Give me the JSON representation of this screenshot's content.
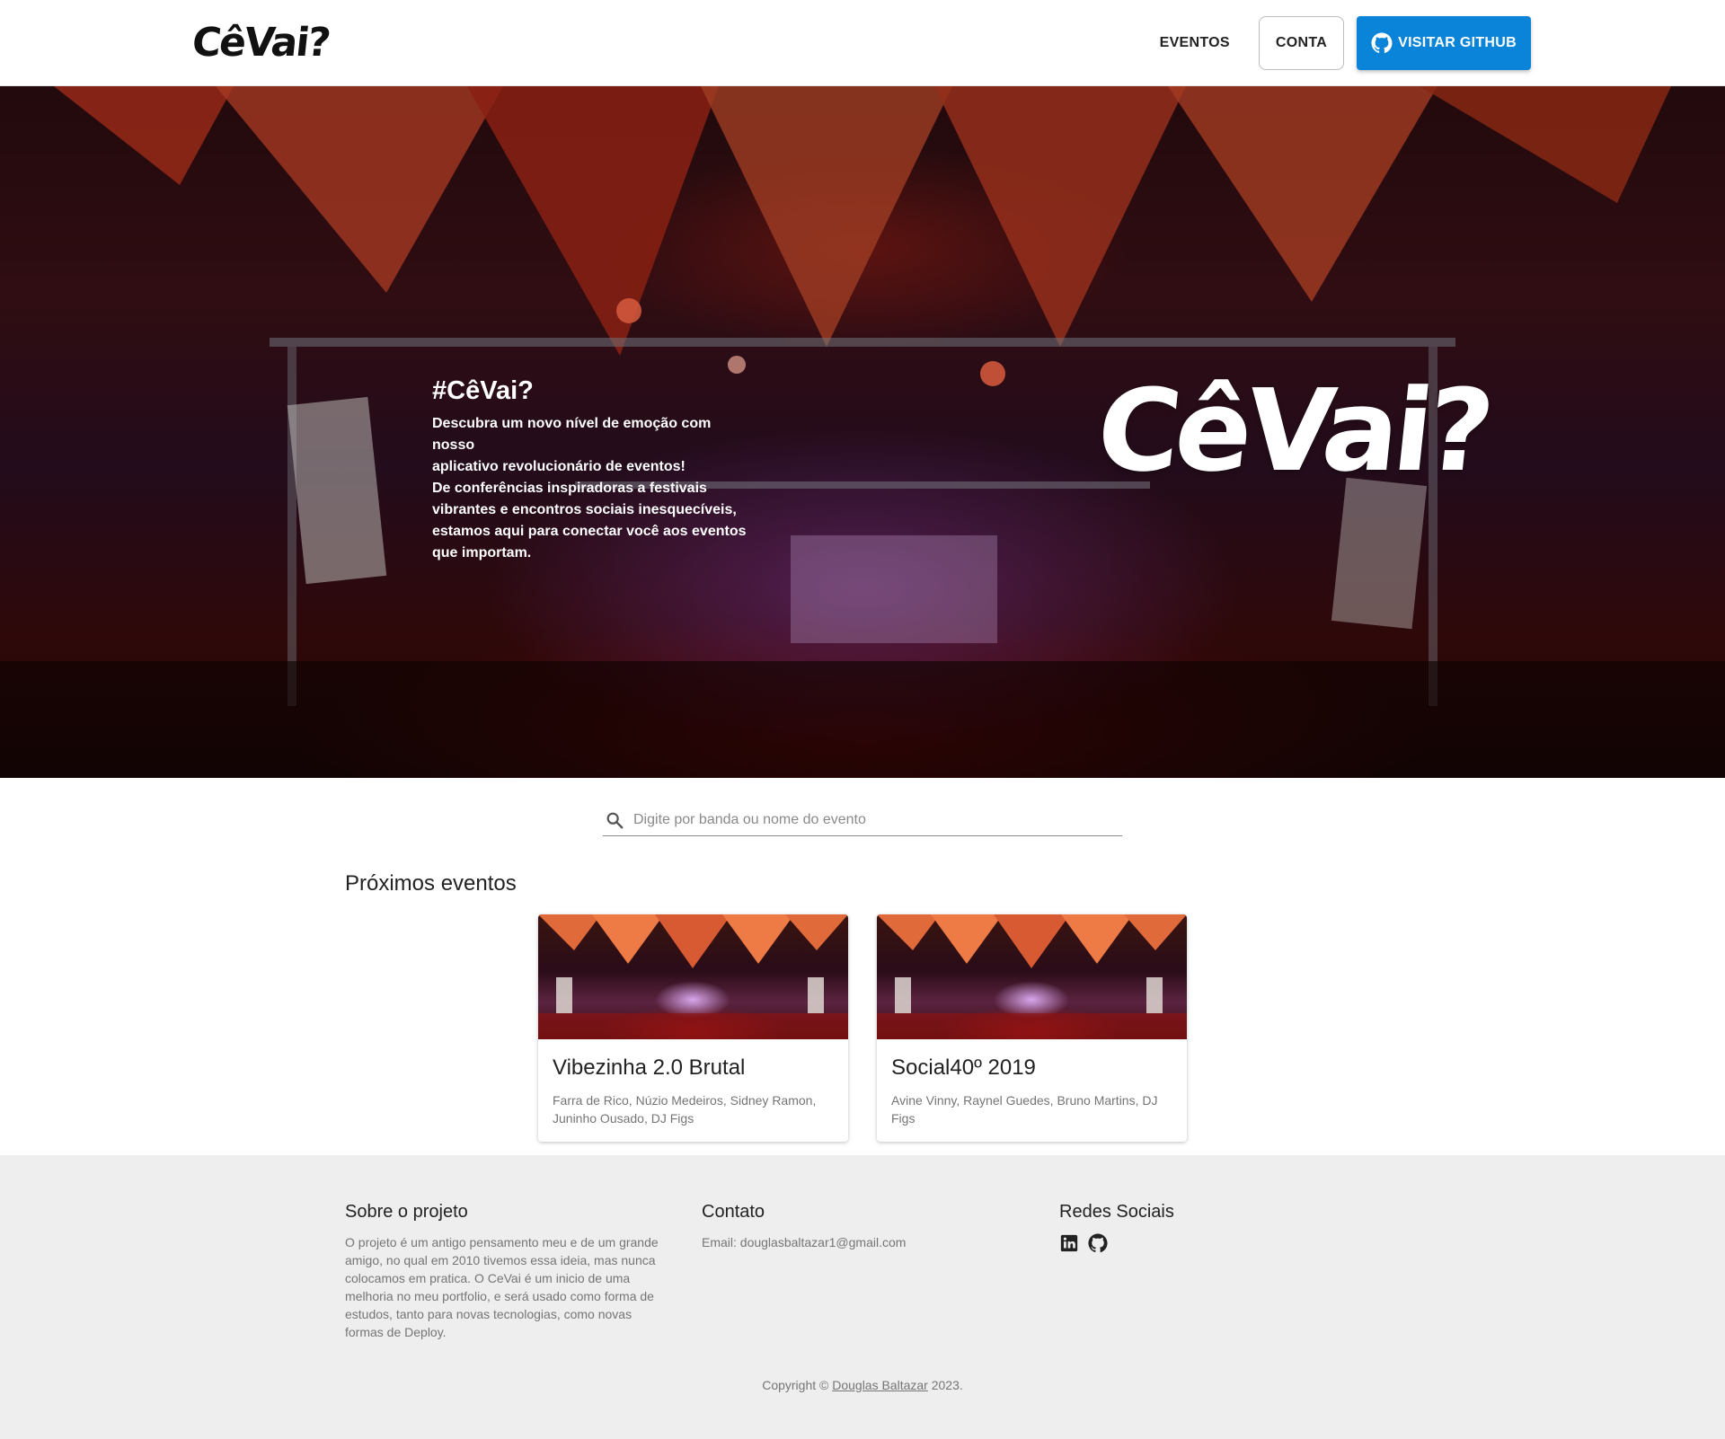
{
  "header": {
    "logo": "CêVai?",
    "nav": {
      "events": "EVENTOS",
      "account": "CONTA",
      "github": "VISITAR GITHUB"
    }
  },
  "hero": {
    "title": "#CêVai?",
    "lines": [
      "Descubra um novo nível de emoção com nosso",
      "aplicativo revolucionário de eventos!",
      "De conferências inspiradoras a festivais",
      "vibrantes e encontros sociais inesquecíveis,",
      "estamos aqui para conectar você aos eventos",
      "que importam."
    ],
    "logo": "CêVai?"
  },
  "search": {
    "placeholder": "Digite por banda ou nome do evento",
    "value": ""
  },
  "events": {
    "section_title": "Próximos eventos",
    "items": [
      {
        "title": "Vibezinha 2.0 Brutal",
        "artists": "Farra de Rico, Núzio Medeiros, Sidney Ramon, Juninho Ousado, DJ Figs"
      },
      {
        "title": "Social40º 2019",
        "artists": "Avine Vinny, Raynel Guedes, Bruno Martins, DJ Figs"
      }
    ]
  },
  "footer": {
    "about": {
      "title": "Sobre o projeto",
      "lines": [
        "O projeto é um antigo pensamento meu e de um grande",
        "amigo, no qual em 2010 tivemos essa ideia, mas nunca",
        "colocamos em pratica. O CeVai é um inicio de uma",
        "melhoria no meu portfolio, e será usado como forma de",
        "estudos, tanto para novas tecnologias, como novas",
        "formas de Deploy."
      ]
    },
    "contact": {
      "title": "Contato",
      "email": "Email: douglasbaltazar1@gmail.com"
    },
    "social": {
      "title": "Redes Sociais",
      "icons": [
        "linkedin-icon",
        "github-icon"
      ]
    },
    "copyright": {
      "prefix": "Copyright © ",
      "author": "Douglas Baltazar",
      "suffix": " 2023."
    }
  },
  "colors": {
    "primary": "#0a84d8",
    "footer_bg": "#eeeeee",
    "text_muted": "#757575"
  }
}
